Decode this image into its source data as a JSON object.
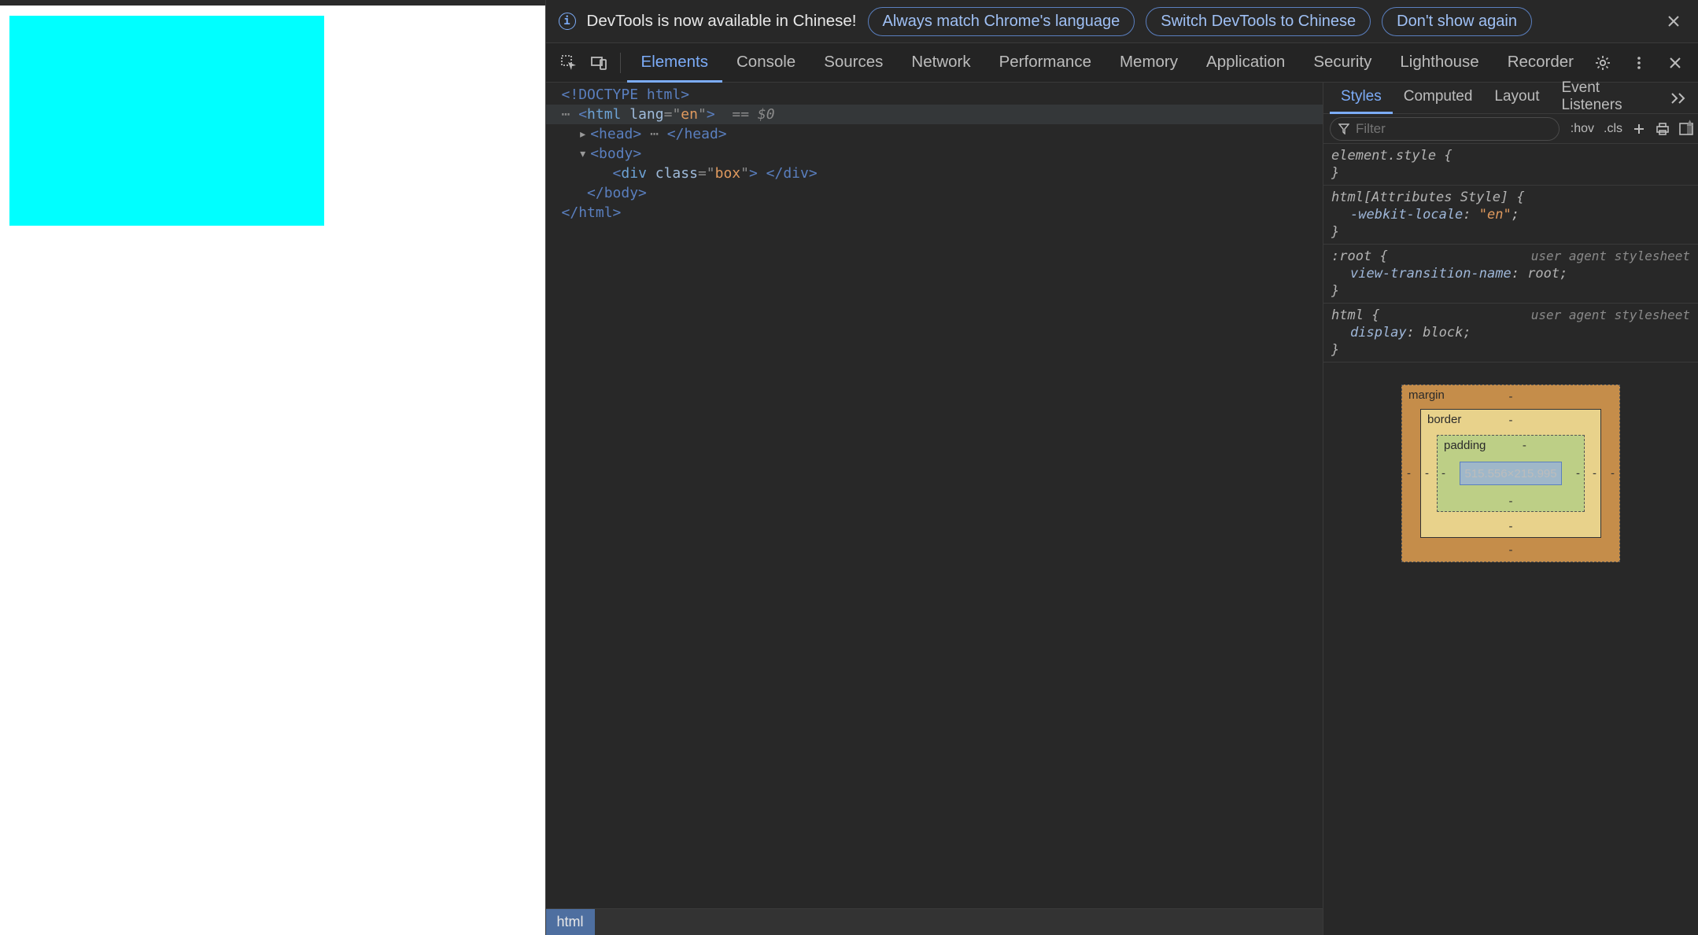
{
  "infobar": {
    "message": "DevTools is now available in Chinese!",
    "btn_match": "Always match Chrome's language",
    "btn_switch": "Switch DevTools to Chinese",
    "btn_dismiss": "Don't show again"
  },
  "tabs": {
    "items": [
      "Elements",
      "Console",
      "Sources",
      "Network",
      "Performance",
      "Memory",
      "Application",
      "Security",
      "Lighthouse",
      "Recorder"
    ],
    "active": "Elements"
  },
  "dom": {
    "doctype": "<!DOCTYPE html>",
    "html_open_1": "<",
    "html_open_tag": "html",
    "html_lang_k": "lang",
    "html_lang_v": "en",
    "html_open_2": ">",
    "head_open": "<head>",
    "head_close": "</head>",
    "body_open": "<body>",
    "div_open_1": "<",
    "div_tag": "div",
    "div_class_k": "class",
    "div_class_v": "box",
    "div_open_2": ">",
    "div_close": "</div>",
    "body_close": "</body>",
    "html_close": "</html>",
    "dollar0": "$0",
    "eqeq": "=="
  },
  "crumb": "html",
  "side_tabs": {
    "items": [
      "Styles",
      "Computed",
      "Layout",
      "Event Listeners"
    ],
    "active": "Styles"
  },
  "filter": {
    "placeholder": "Filter",
    "hov": ":hov",
    "cls": ".cls"
  },
  "rules": [
    {
      "selector": "element.style",
      "ua": false,
      "decls": []
    },
    {
      "selector": "html[Attributes Style]",
      "ua": false,
      "decls": [
        {
          "prop": "-webkit-locale",
          "val": "\"en\"",
          "str": true
        }
      ]
    },
    {
      "selector": ":root",
      "ua": true,
      "decls": [
        {
          "prop": "view-transition-name",
          "val": "root;",
          "str": false
        }
      ]
    },
    {
      "selector": "html",
      "ua": true,
      "decls": [
        {
          "prop": "display",
          "val": "block;",
          "str": false
        }
      ]
    }
  ],
  "ua_label": "user agent stylesheet",
  "boxmodel": {
    "margin": "margin",
    "border": "border",
    "padding": "padding",
    "content": "515.556×215.995",
    "dash": "-"
  }
}
